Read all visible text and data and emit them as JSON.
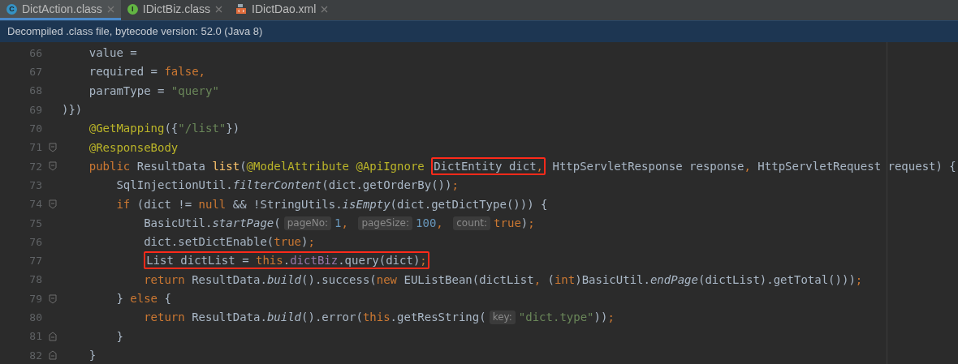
{
  "tabs": [
    {
      "label": "DictAction.class",
      "kind": "class",
      "icon_letter": "C",
      "selected": true
    },
    {
      "label": "IDictBiz.class",
      "kind": "interface",
      "icon_letter": "I",
      "selected": false
    },
    {
      "label": "IDictDao.xml",
      "kind": "xml",
      "selected": false
    }
  ],
  "banner": {
    "text": "Decompiled .class file, bytecode version: 52.0 (Java 8)"
  },
  "editor": {
    "lines": [
      {
        "number": "66",
        "tokens": [
          {
            "kind": "plain",
            "text": "    value = "
          }
        ]
      },
      {
        "number": "67",
        "tokens": [
          {
            "kind": "plain",
            "text": "    required = "
          },
          {
            "kind": "keyword",
            "text": "false"
          },
          {
            "kind": "punct",
            "text": ","
          }
        ]
      },
      {
        "number": "68",
        "tokens": [
          {
            "kind": "plain",
            "text": "    paramType = "
          },
          {
            "kind": "string",
            "text": "\"query\""
          }
        ]
      },
      {
        "number": "69",
        "tokens": [
          {
            "kind": "plain",
            "text": ")})"
          }
        ]
      },
      {
        "number": "70",
        "tokens": [
          {
            "kind": "annotation",
            "text": "    @GetMapping"
          },
          {
            "kind": "plain",
            "text": "({"
          },
          {
            "kind": "string",
            "text": "\"/list\""
          },
          {
            "kind": "plain",
            "text": "})"
          }
        ]
      },
      {
        "number": "71",
        "fold": {
          "kind": "start"
        },
        "tokens": [
          {
            "kind": "annotation",
            "text": "    @ResponseBody"
          }
        ]
      },
      {
        "number": "72",
        "fold": {
          "kind": "start"
        },
        "tokens": [
          {
            "kind": "keyword",
            "text": "    public "
          },
          {
            "kind": "plain",
            "text": "ResultData "
          },
          {
            "kind": "decl",
            "text": "list"
          },
          {
            "kind": "plain",
            "text": "("
          },
          {
            "kind": "annotation",
            "text": "@ModelAttribute @ApiIgnore "
          },
          {
            "kind": "box",
            "tokens": [
              {
                "kind": "plain",
                "text": "DictEntity dict"
              },
              {
                "kind": "punct",
                "text": ","
              }
            ]
          },
          {
            "kind": "plain",
            "text": " HttpServletResponse response"
          },
          {
            "kind": "punct",
            "text": ","
          },
          {
            "kind": "plain",
            "text": " HttpServletRequest request) {"
          }
        ]
      },
      {
        "number": "73",
        "tokens": [
          {
            "kind": "plain",
            "text": "        SqlInjectionUtil."
          },
          {
            "kind": "static",
            "text": "filterContent"
          },
          {
            "kind": "plain",
            "text": "(dict.getOrderBy())"
          },
          {
            "kind": "punct",
            "text": ";"
          }
        ]
      },
      {
        "number": "74",
        "fold": {
          "kind": "start"
        },
        "tokens": [
          {
            "kind": "keyword",
            "text": "        if "
          },
          {
            "kind": "plain",
            "text": "(dict != "
          },
          {
            "kind": "keyword",
            "text": "null "
          },
          {
            "kind": "plain",
            "text": "&& !StringUtils."
          },
          {
            "kind": "static",
            "text": "isEmpty"
          },
          {
            "kind": "plain",
            "text": "(dict.getDictType())) {"
          }
        ]
      },
      {
        "number": "75",
        "tokens": [
          {
            "kind": "plain",
            "text": "            BasicUtil."
          },
          {
            "kind": "static",
            "text": "startPage"
          },
          {
            "kind": "plain",
            "text": "("
          },
          {
            "kind": "hint",
            "text": "pageNo:"
          },
          {
            "kind": "number",
            "text": "1"
          },
          {
            "kind": "punct",
            "text": ", "
          },
          {
            "kind": "hint",
            "text": "pageSize:"
          },
          {
            "kind": "number",
            "text": "100"
          },
          {
            "kind": "punct",
            "text": ", "
          },
          {
            "kind": "hint",
            "text": "count:"
          },
          {
            "kind": "keyword",
            "text": "true"
          },
          {
            "kind": "plain",
            "text": ")"
          },
          {
            "kind": "punct",
            "text": ";"
          }
        ]
      },
      {
        "number": "76",
        "tokens": [
          {
            "kind": "plain",
            "text": "            dict.setDictEnable("
          },
          {
            "kind": "keyword",
            "text": "true"
          },
          {
            "kind": "plain",
            "text": ")"
          },
          {
            "kind": "punct",
            "text": ";"
          }
        ]
      },
      {
        "number": "77",
        "tokens": [
          {
            "kind": "indent3"
          },
          {
            "kind": "box",
            "tokens": [
              {
                "kind": "plain",
                "text": "List dictList = "
              },
              {
                "kind": "keyword",
                "text": "this"
              },
              {
                "kind": "plain",
                "text": "."
              },
              {
                "kind": "field",
                "text": "dictBiz"
              },
              {
                "kind": "plain",
                "text": ".query(dict)"
              },
              {
                "kind": "punct",
                "text": ";"
              }
            ]
          }
        ]
      },
      {
        "number": "78",
        "tokens": [
          {
            "kind": "keyword",
            "text": "            return "
          },
          {
            "kind": "plain",
            "text": "ResultData."
          },
          {
            "kind": "static",
            "text": "build"
          },
          {
            "kind": "plain",
            "text": "().success("
          },
          {
            "kind": "keyword",
            "text": "new "
          },
          {
            "kind": "plain",
            "text": "EUListBean(dictList"
          },
          {
            "kind": "punct",
            "text": ","
          },
          {
            "kind": "plain",
            "text": " ("
          },
          {
            "kind": "keyword",
            "text": "int"
          },
          {
            "kind": "plain",
            "text": ")BasicUtil."
          },
          {
            "kind": "static",
            "text": "endPage"
          },
          {
            "kind": "plain",
            "text": "(dictList).getTotal()))"
          },
          {
            "kind": "punct",
            "text": ";"
          }
        ]
      },
      {
        "number": "79",
        "fold": {
          "kind": "start"
        },
        "tokens": [
          {
            "kind": "plain",
            "text": "        } "
          },
          {
            "kind": "keyword",
            "text": "else "
          },
          {
            "kind": "plain",
            "text": "{"
          }
        ]
      },
      {
        "number": "80",
        "tokens": [
          {
            "kind": "keyword",
            "text": "            return "
          },
          {
            "kind": "plain",
            "text": "ResultData."
          },
          {
            "kind": "static",
            "text": "build"
          },
          {
            "kind": "plain",
            "text": "().error("
          },
          {
            "kind": "keyword",
            "text": "this"
          },
          {
            "kind": "plain",
            "text": ".getResString("
          },
          {
            "kind": "hint",
            "text": "key:"
          },
          {
            "kind": "string",
            "text": "\"dict.type\""
          },
          {
            "kind": "plain",
            "text": "))"
          },
          {
            "kind": "punct",
            "text": ";"
          }
        ]
      },
      {
        "number": "81",
        "fold": {
          "kind": "end"
        },
        "tokens": [
          {
            "kind": "plain",
            "text": "        }"
          }
        ]
      },
      {
        "number": "82",
        "fold": {
          "kind": "end"
        },
        "tokens": [
          {
            "kind": "plain",
            "text": "    }"
          }
        ]
      }
    ]
  }
}
